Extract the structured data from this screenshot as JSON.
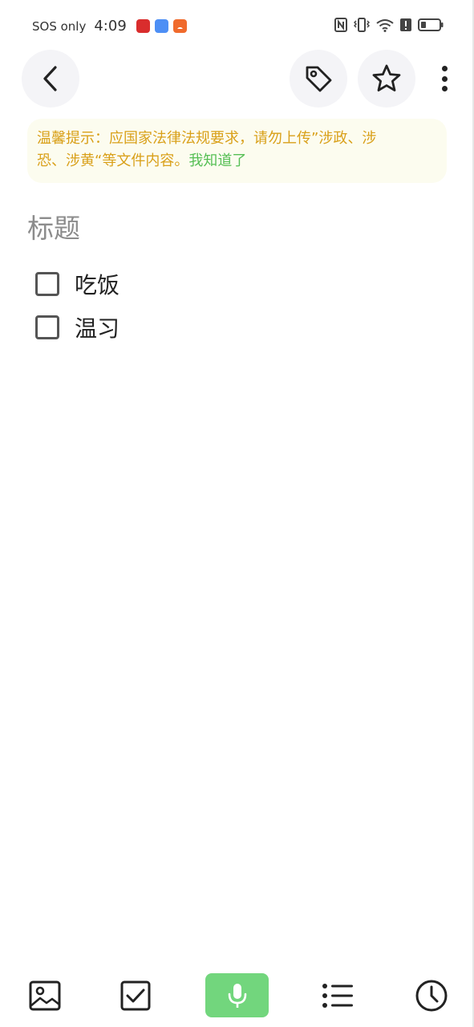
{
  "status_bar": {
    "carrier": "SOS only",
    "time": "4:09",
    "icons": [
      "red-app-icon",
      "blue-app-icon",
      "download-icon",
      "nfc-icon",
      "vibrate-icon",
      "wifi-icon",
      "alert-icon",
      "battery-icon"
    ]
  },
  "toolbar": {
    "icons": [
      "back-icon",
      "tag-icon",
      "star-icon",
      "more-icon"
    ]
  },
  "notice": {
    "line1": "温馨提示：应国家法律法规要求，请勿上传”涉政、涉",
    "line2": "恐、涉黄“等文件内容。",
    "ack": "我知道了",
    "text_color": "#d9a019",
    "ack_color": "#56bf55"
  },
  "note": {
    "title_placeholder": "标题",
    "items": [
      {
        "text": "吃饭",
        "checked": false
      },
      {
        "text": "温习",
        "checked": false
      }
    ]
  },
  "bottom_bar": {
    "icons": [
      "image-icon",
      "checklist-icon",
      "microphone-icon",
      "bullet-list-icon",
      "clock-icon"
    ],
    "accent_color": "#72d67d"
  }
}
